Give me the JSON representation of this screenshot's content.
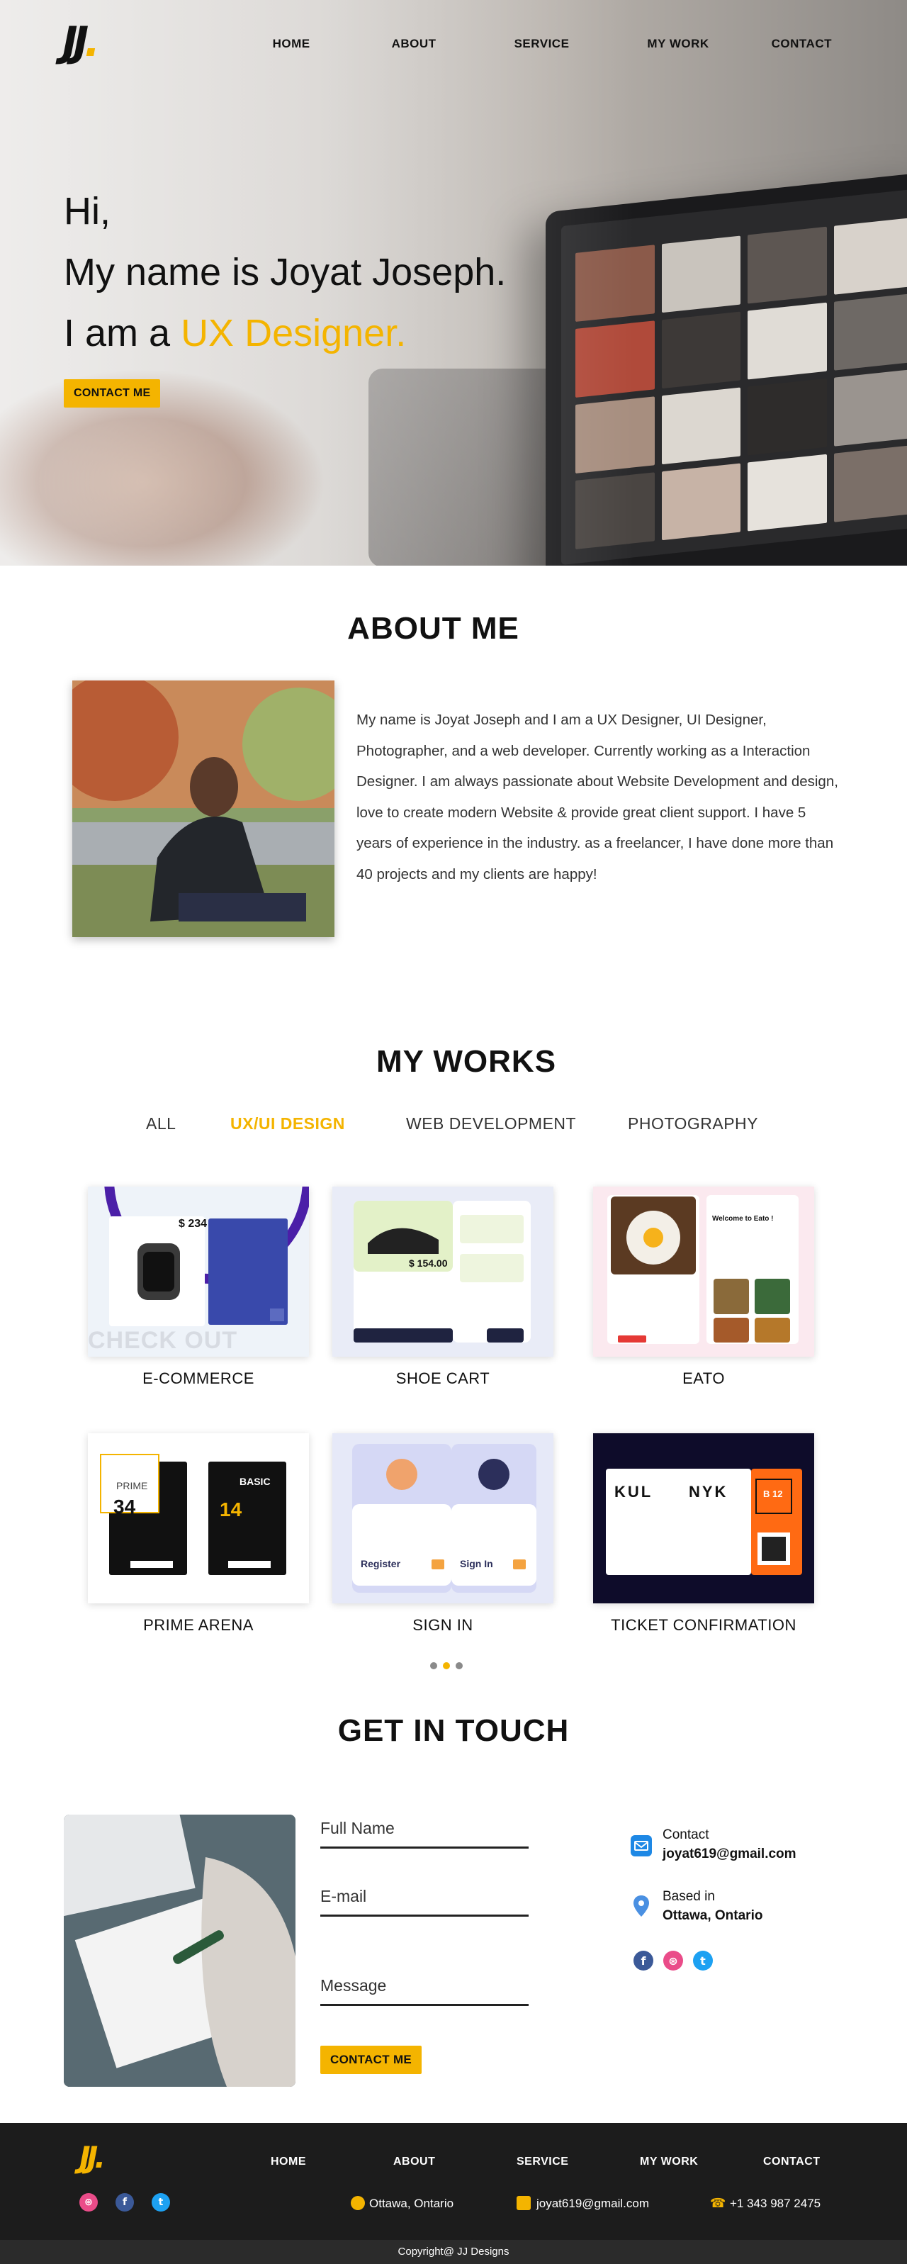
{
  "brand": {
    "logo": "JJ",
    "logo_dot": "."
  },
  "nav": {
    "items": [
      "HOME",
      "ABOUT",
      "SERVICE",
      "MY WORK",
      "CONTACT"
    ]
  },
  "hero": {
    "line1": "Hi,",
    "line2": "My name is Joyat Joseph.",
    "line3_prefix": "I am a ",
    "line3_accent": "UX Designer.",
    "cta": "CONTACT ME"
  },
  "about": {
    "title": "ABOUT ME",
    "text": "My name is Joyat Joseph and I am a UX Designer, UI Designer, Photographer, and a web developer. Currently working as a Interaction Designer. I am always passionate about Website Development and design, love to create modern Website & provide great client support. I have 5 years of experience in the industry. as a freelancer, I have done more than 40 projects and my clients are happy!"
  },
  "works": {
    "title": "MY WORKS",
    "filters": [
      "ALL",
      "UX/UI DESIGN",
      "WEB DEVELOPMENT",
      "PHOTOGRAPHY"
    ],
    "active_filter": "UX/UI DESIGN",
    "projects": [
      {
        "label": "E-COMMERCE",
        "bg_text": "CHECK OUT",
        "price": "$ 234"
      },
      {
        "label": "SHOE CART",
        "price": "$ 154.00"
      },
      {
        "label": "EATO",
        "greeting": "Welcome to Eato !"
      },
      {
        "label": "PRIME ARENA",
        "plan1": "PRIME",
        "plan2": "BASIC",
        "price1": "34",
        "price2": "14"
      },
      {
        "label": "SIGN IN",
        "btn1": "Register",
        "btn2": "Sign In"
      },
      {
        "label": "TICKET CONFIRMATION",
        "from": "KUL",
        "to": "NYK",
        "seat": "B 12"
      }
    ]
  },
  "contact": {
    "title": "GET IN TOUCH",
    "fields": [
      "Full Name",
      "E-mail",
      "Message"
    ],
    "button": "CONTACT ME",
    "email_label": "Contact",
    "email": "joyat619@gmail.com",
    "location_label": "Based in",
    "location": "Ottawa, Ontario"
  },
  "footer": {
    "logo": "JJ.",
    "nav": [
      "HOME",
      "ABOUT",
      "SERVICE",
      "MY WORK",
      "CONTACT"
    ],
    "location": "Ottawa, Ontario",
    "email": "joyat619@gmail.com",
    "phone": "+1 343 987 2475",
    "copyright": "Copyright@ JJ Designs"
  },
  "colors": {
    "accent": "#f4b400",
    "footer": "#1c1c1c"
  },
  "icons": [
    "mail-icon",
    "location-icon",
    "facebook-icon",
    "dribbble-icon",
    "twitter-icon",
    "phone-icon"
  ]
}
